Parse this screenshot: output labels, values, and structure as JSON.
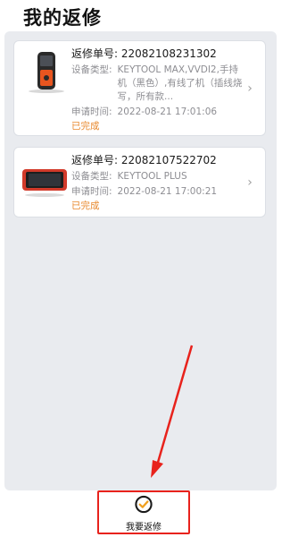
{
  "page": {
    "title": "我的返修"
  },
  "colors": {
    "accent_red": "#e8221c",
    "status_orange": "#e8882d",
    "background_gray": "#e9ebef"
  },
  "orders": [
    {
      "order_label": "返修单号:",
      "order_no": "22082108231302",
      "device_type_label": "设备类型:",
      "device_type": "KEYTOOL MAX,VVDI2,手持机（黑色）,有线了机（插线烧写，所有款...",
      "apply_time_label": "申请时间:",
      "apply_time": "2022-08-21 17:01:06",
      "status": "已完成",
      "thumbnail_icon": "handheld-key-programmer-icon"
    },
    {
      "order_label": "返修单号:",
      "order_no": "22082107522702",
      "device_type_label": "设备类型:",
      "device_type": "KEYTOOL PLUS",
      "apply_time_label": "申请时间:",
      "apply_time": "2022-08-21 17:00:21",
      "status": "已完成",
      "thumbnail_icon": "tablet-device-icon"
    }
  ],
  "bottom": {
    "repair_button_label": "我要返修",
    "repair_button_icon": "check-circle-icon"
  }
}
